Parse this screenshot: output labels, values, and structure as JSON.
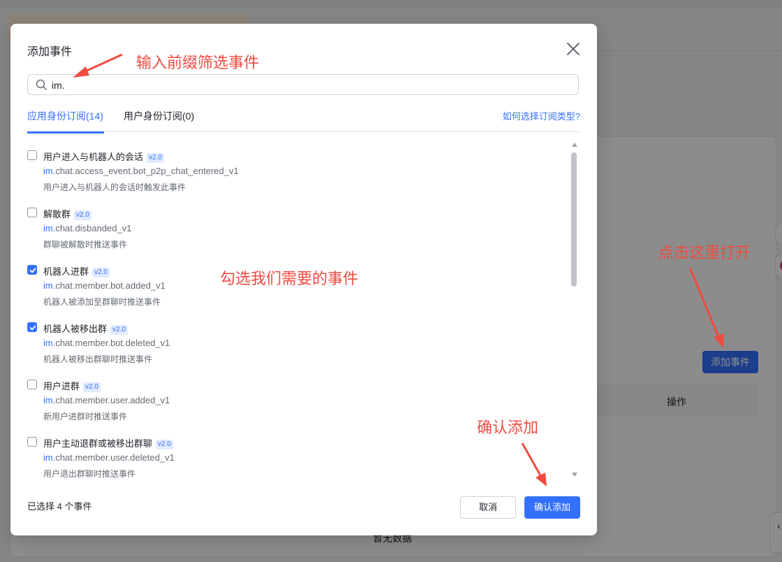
{
  "background": {
    "add_event_button": "添加事件",
    "table_header_operation": "操作",
    "empty_text": "暂无数据",
    "float_button_text": "‹"
  },
  "modal": {
    "title": "添加事件",
    "close_icon": "close-icon",
    "search": {
      "value": "im.",
      "icon": "search-icon"
    },
    "tabs": [
      {
        "label": "应用身份订阅(14)",
        "active": true
      },
      {
        "label": "用户身份订阅(0)",
        "active": false
      }
    ],
    "help_link": "如何选择订阅类型?",
    "events": [
      {
        "name": "用户进入与机器人的会话",
        "version": "v2.0",
        "key_prefix": "im",
        "key_rest": ".chat.access_event.bot_p2p_chat_entered_v1",
        "desc": "用户进入与机器人的会话时触发此事件",
        "checked": false
      },
      {
        "name": "解散群",
        "version": "v2.0",
        "key_prefix": "im",
        "key_rest": ".chat.disbanded_v1",
        "desc": "群聊被解散时推送事件",
        "checked": false
      },
      {
        "name": "机器人进群",
        "version": "v2.0",
        "key_prefix": "im",
        "key_rest": ".chat.member.bot.added_v1",
        "desc": "机器人被添加至群聊时推送事件",
        "checked": true
      },
      {
        "name": "机器人被移出群",
        "version": "v2.0",
        "key_prefix": "im",
        "key_rest": ".chat.member.bot.deleted_v1",
        "desc": "机器人被移出群聊时推送事件",
        "checked": true
      },
      {
        "name": "用户进群",
        "version": "v2.0",
        "key_prefix": "im",
        "key_rest": ".chat.member.user.added_v1",
        "desc": "新用户进群时推送事件",
        "checked": false
      },
      {
        "name": "用户主动退群或被移出群聊",
        "version": "v2.0",
        "key_prefix": "im",
        "key_rest": ".chat.member.user.deleted_v1",
        "desc": "用户退出群聊时推送事件",
        "checked": false
      }
    ],
    "selected_count": "已选择 4 个事件",
    "cancel_label": "取消",
    "confirm_label": "确认添加"
  },
  "annotations": {
    "search_hint": "输入前缀筛选事件",
    "check_hint": "勾选我们需要的事件",
    "open_hint": "点击这里打开",
    "confirm_hint": "确认添加",
    "color": "#f04b41"
  },
  "colors": {
    "primary": "#3370ff",
    "text": "#1f2329",
    "secondary_text": "#646a73"
  }
}
